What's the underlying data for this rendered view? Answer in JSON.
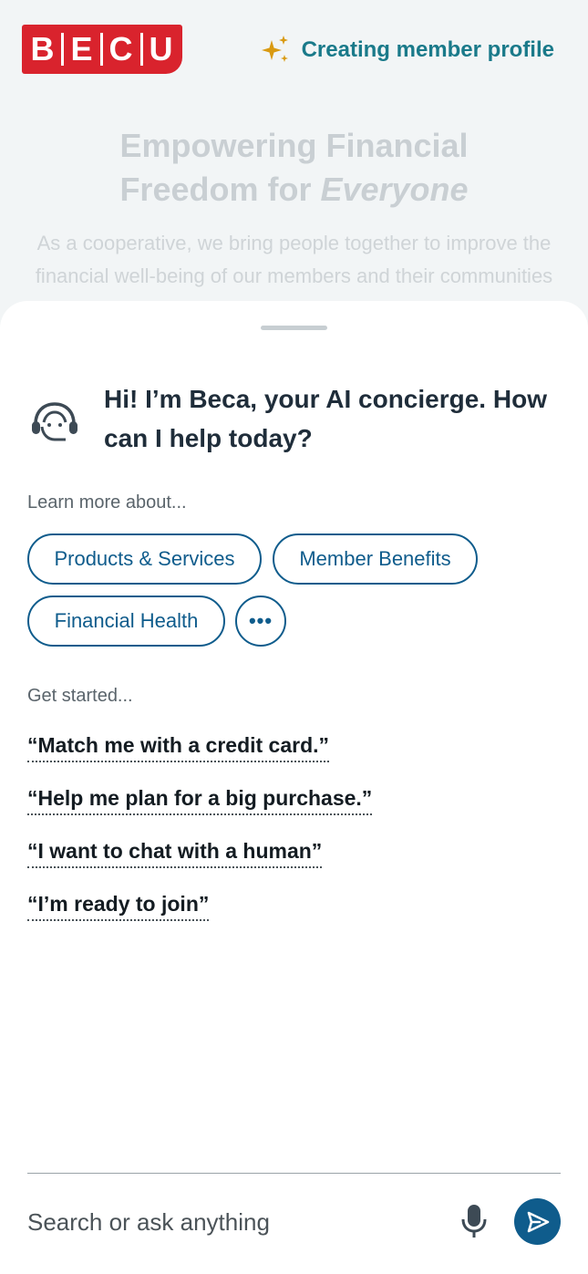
{
  "header": {
    "logo_letters": [
      "B",
      "E",
      "C",
      "U"
    ],
    "status_text": "Creating member profile",
    "sparkle_color": "#d99a12"
  },
  "hero": {
    "title_line1": "Empowering Financial",
    "title_line2_prefix": "Freedom for ",
    "title_line2_emphasis": "Everyone",
    "subtitle": "As a cooperative, we bring people together to improve the financial well-being of our members and their communities"
  },
  "assistant": {
    "greeting": "Hi! I’m Beca, your AI concierge. How can I help today?",
    "learn_label": "Learn more about...",
    "chips": [
      "Products & Services",
      "Member Benefits",
      "Financial Health"
    ],
    "more_label": "•••",
    "started_label": "Get started...",
    "prompts": [
      "“Match me with a credit card.”",
      "“Help me plan for a big purchase.”",
      "“I want to chat with a human”",
      "“I’m ready to join”"
    ]
  },
  "input": {
    "placeholder": "Search or ask anything"
  },
  "colors": {
    "brand_red": "#d9232d",
    "brand_blue": "#0f5c8c",
    "status_teal": "#1a7a8a"
  }
}
